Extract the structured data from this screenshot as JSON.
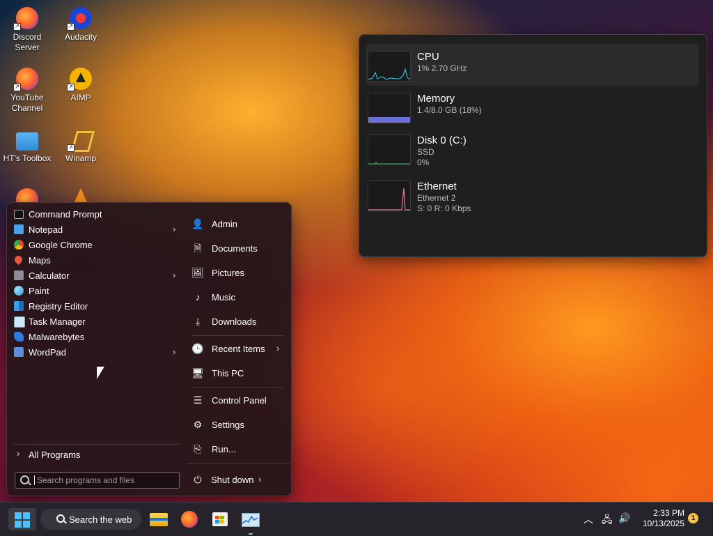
{
  "desktop": {
    "icons": [
      {
        "label": "Discord\nServer",
        "icon": "firefox-icon"
      },
      {
        "label": "Audacity",
        "icon": "audacity-icon"
      },
      {
        "label": "YouTube\nChannel",
        "icon": "firefox-icon"
      },
      {
        "label": "AIMP",
        "icon": "aimp-icon"
      },
      {
        "label": "HT's Toolbox",
        "icon": "folder-icon"
      },
      {
        "label": "Winamp",
        "icon": "winamp-icon"
      }
    ]
  },
  "performance": {
    "items": [
      {
        "name": "CPU",
        "line1": "1% 2.70 GHz",
        "line2": ""
      },
      {
        "name": "Memory",
        "line1": "1.4/8.0 GB (18%)",
        "line2": ""
      },
      {
        "name": "Disk 0 (C:)",
        "line1": "SSD",
        "line2": "0%"
      },
      {
        "name": "Ethernet",
        "line1": "Ethernet 2",
        "line2": "S: 0 R: 0 Kbps"
      }
    ],
    "colors": {
      "cpu": "#3ab5d8",
      "memory": "#6b6fd6",
      "disk": "#4bbf73",
      "ethernet": "#e07aa0"
    },
    "memory_fraction": 0.18
  },
  "start_menu": {
    "programs": [
      {
        "label": "Command Prompt",
        "icon": "command-prompt-icon",
        "submenu": false
      },
      {
        "label": "Notepad",
        "icon": "notepad-icon",
        "submenu": true
      },
      {
        "label": "Google Chrome",
        "icon": "chrome-icon",
        "submenu": false
      },
      {
        "label": "Maps",
        "icon": "maps-icon",
        "submenu": false
      },
      {
        "label": "Calculator",
        "icon": "calculator-icon",
        "submenu": true
      },
      {
        "label": "Paint",
        "icon": "paint-icon",
        "submenu": false
      },
      {
        "label": "Registry Editor",
        "icon": "registry-editor-icon",
        "submenu": false
      },
      {
        "label": "Task Manager",
        "icon": "task-manager-icon",
        "submenu": false
      },
      {
        "label": "Malwarebytes",
        "icon": "malwarebytes-icon",
        "submenu": false
      },
      {
        "label": "WordPad",
        "icon": "wordpad-icon",
        "submenu": true
      }
    ],
    "all_programs": "All Programs",
    "search_placeholder": "Search programs and files",
    "places": [
      {
        "label": "Admin",
        "icon": "user-icon"
      },
      {
        "label": "Documents",
        "icon": "document-icon"
      },
      {
        "label": "Pictures",
        "icon": "pictures-icon"
      },
      {
        "label": "Music",
        "icon": "music-icon"
      },
      {
        "label": "Downloads",
        "icon": "download-icon"
      },
      {
        "label": "Recent Items",
        "icon": "clock-icon"
      },
      {
        "label": "This PC",
        "icon": "computer-icon"
      },
      {
        "label": "Control Panel",
        "icon": "control-panel-icon"
      },
      {
        "label": "Settings",
        "icon": "gear-icon"
      },
      {
        "label": "Run...",
        "icon": "run-icon"
      }
    ],
    "shutdown": "Shut down"
  },
  "taskbar": {
    "search_label": "Search the web",
    "apps": [
      "file-explorer-icon",
      "firefox-icon",
      "microsoft-store-icon",
      "task-manager-icon"
    ],
    "time": "2:33 PM",
    "date": "10/13/2025",
    "notification_count": "1",
    "accent": "#4cc2ff"
  }
}
